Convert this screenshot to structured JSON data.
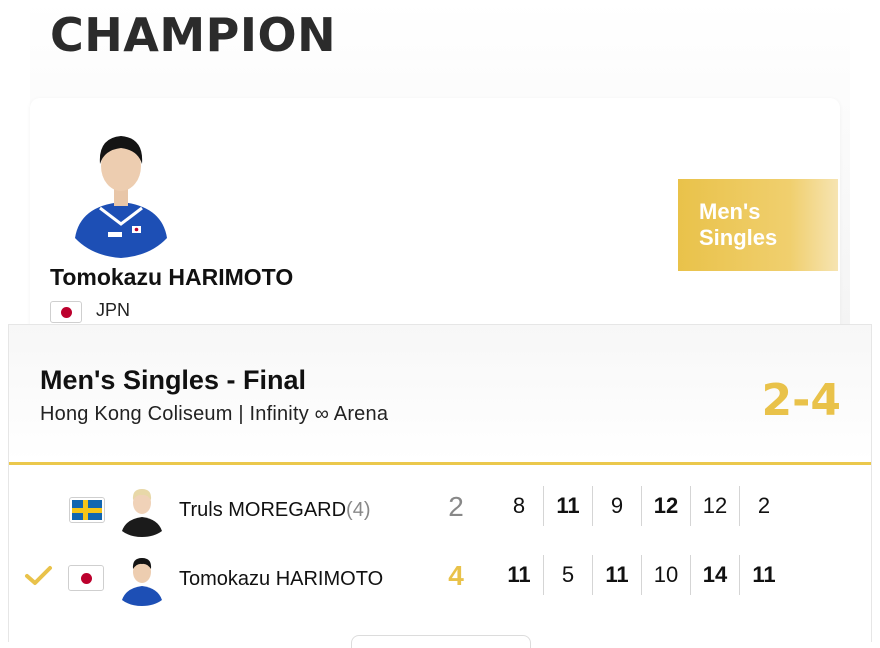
{
  "champion": {
    "heading": "CHAMPION",
    "name": "Tomokazu HARIMOTO",
    "country": "JPN",
    "event_badge": "Men's Singles"
  },
  "match": {
    "title": "Men's Singles - Final",
    "venue": "Hong Kong Coliseum | Infinity ∞ Arena",
    "score": "2-4",
    "players": [
      {
        "name": "Truls MOREGARD",
        "seed": "(4)",
        "country": "SWE",
        "sets": "2",
        "winner": false,
        "games": [
          "8",
          "11",
          "9",
          "12",
          "12",
          "2"
        ]
      },
      {
        "name": "Tomokazu HARIMOTO",
        "seed": "",
        "country": "JPN",
        "sets": "4",
        "winner": true,
        "games": [
          "11",
          "5",
          "11",
          "10",
          "14",
          "11"
        ]
      }
    ]
  },
  "colors": {
    "accent": "#e9c24a",
    "jpn_red": "#bc002d",
    "swe_blue": "#1266b0",
    "swe_yellow": "#f5c518"
  },
  "icons": {
    "winner": "checkmark-icon",
    "flag_jpn": "flag-jpn-icon",
    "flag_swe": "flag-swe-icon"
  }
}
